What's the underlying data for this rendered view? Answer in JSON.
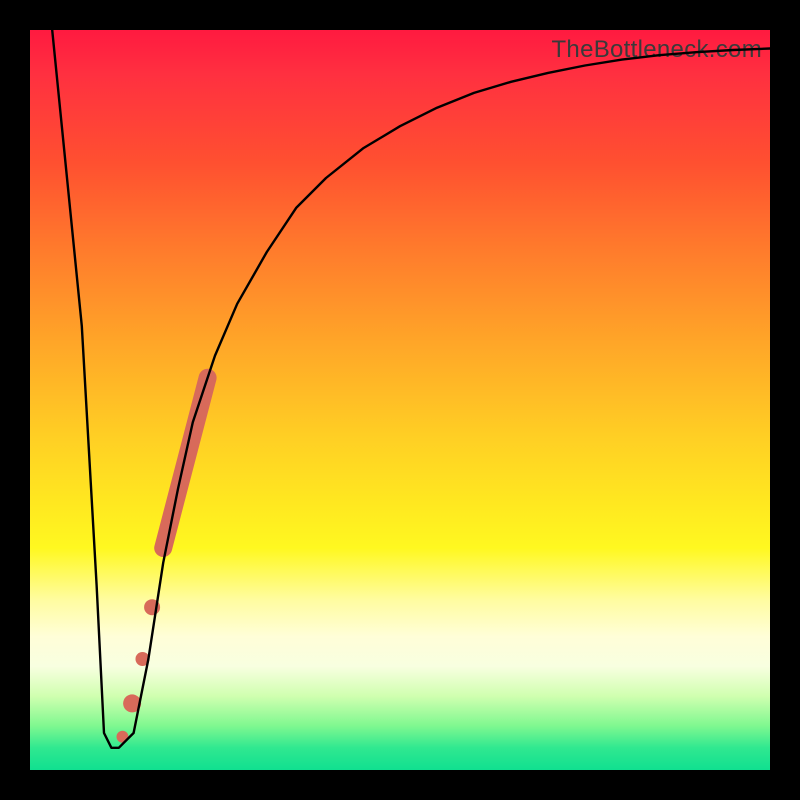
{
  "watermark": "TheBottleneck.com",
  "chart_data": {
    "type": "line",
    "title": "",
    "xlabel": "",
    "ylabel": "",
    "xlim": [
      0,
      100
    ],
    "ylim": [
      0,
      100
    ],
    "grid": false,
    "legend": false,
    "series": [
      {
        "name": "bottleneck-curve",
        "color": "#000000",
        "x": [
          3,
          5,
          7,
          9,
          10,
          11,
          12,
          14,
          16,
          18,
          20,
          22,
          25,
          28,
          32,
          36,
          40,
          45,
          50,
          55,
          60,
          65,
          70,
          75,
          80,
          85,
          90,
          95,
          100
        ],
        "y": [
          100,
          80,
          60,
          25,
          5,
          3,
          3,
          5,
          15,
          28,
          38,
          47,
          56,
          63,
          70,
          76,
          80,
          84,
          87,
          89.5,
          91.5,
          93,
          94.2,
          95.2,
          96,
          96.6,
          97,
          97.3,
          97.5
        ]
      }
    ],
    "markers": [
      {
        "name": "highlight-segment",
        "shape": "capsule",
        "color": "#d86a5a",
        "x1": 18,
        "y1": 30,
        "x2": 24,
        "y2": 53,
        "width": 18
      },
      {
        "name": "highlight-dot-1",
        "shape": "circle",
        "color": "#d86a5a",
        "x": 16.5,
        "y": 22,
        "r": 8
      },
      {
        "name": "highlight-dot-2",
        "shape": "circle",
        "color": "#d86a5a",
        "x": 15.2,
        "y": 15,
        "r": 7
      },
      {
        "name": "highlight-dot-3",
        "shape": "circle",
        "color": "#d86a5a",
        "x": 13.8,
        "y": 9,
        "r": 9
      },
      {
        "name": "highlight-dot-4",
        "shape": "circle",
        "color": "#d86a5a",
        "x": 12.5,
        "y": 4.5,
        "r": 6
      }
    ],
    "gradient_stops": [
      {
        "pos": 0.0,
        "color": "#ff1a40"
      },
      {
        "pos": 0.3,
        "color": "#ff7c2c"
      },
      {
        "pos": 0.55,
        "color": "#ffcf24"
      },
      {
        "pos": 0.82,
        "color": "#fffed8"
      },
      {
        "pos": 1.0,
        "color": "#10e090"
      }
    ]
  }
}
